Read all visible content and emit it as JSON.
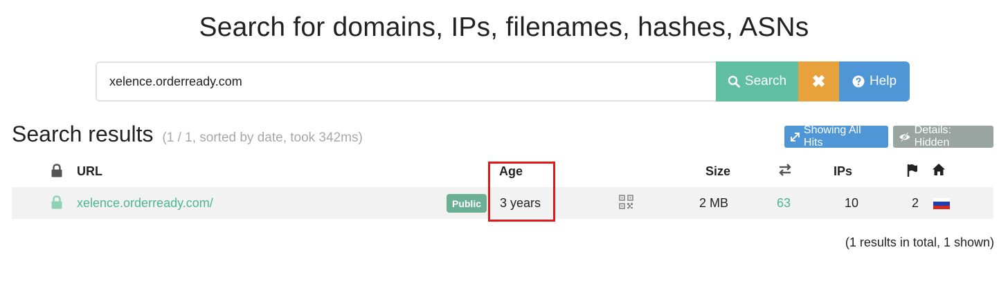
{
  "page": {
    "title": "Search for domains, IPs, filenames, hashes, ASNs"
  },
  "search": {
    "value": "xelence.orderready.com",
    "search_label": "Search",
    "clear_label": "✖",
    "help_label": "Help"
  },
  "results": {
    "heading": "Search results",
    "meta": "(1 / 1, sorted by date, took 342ms)",
    "showing_all_hits": "Showing All Hits",
    "details_hidden": "Details: Hidden",
    "footer_note": "(1 results in total, 1 shown)"
  },
  "table": {
    "headers": {
      "url": "URL",
      "age": "Age",
      "size": "Size",
      "ips": "IPs"
    },
    "rows": [
      {
        "url": "xelence.orderready.com/",
        "visibility": "Public",
        "age": "3 years",
        "size": "2 MB",
        "requests": "63",
        "ips": "10",
        "countries": "2",
        "country_flag": "russia-flag-icon"
      }
    ]
  },
  "colors": {
    "search_button": "#5fbfa0",
    "clear_button": "#e8a23c",
    "help_button": "#4e96d6",
    "link": "#4db592",
    "highlight_box": "#e01818"
  }
}
